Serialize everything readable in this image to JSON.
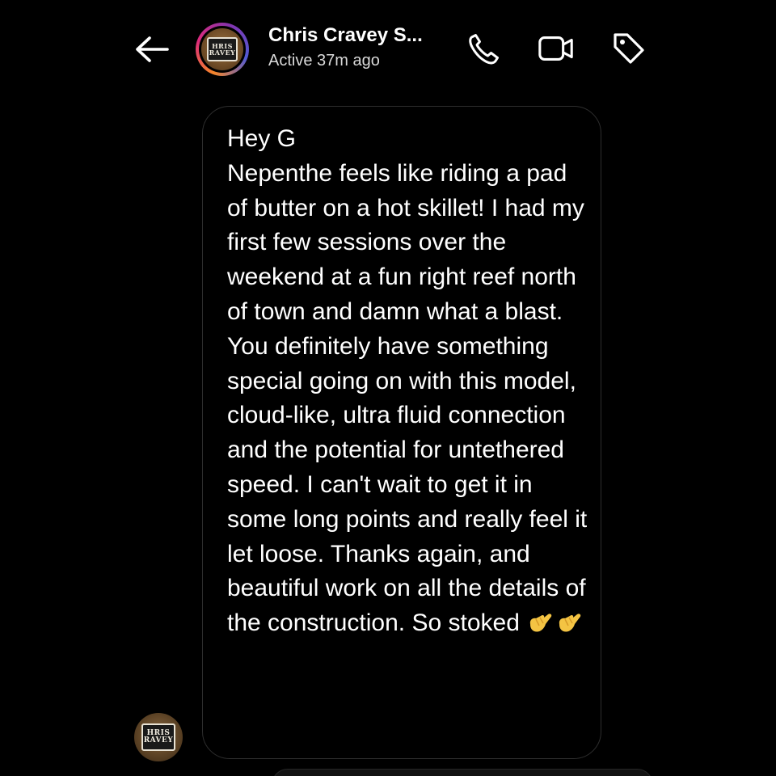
{
  "header": {
    "back_icon": "arrow-left-icon",
    "contact_name": "Chris Cravey S...",
    "status": "Active 37m ago",
    "avatar_logo_lines": [
      "HRIS",
      "RAVEY"
    ],
    "actions": [
      {
        "name": "voice-call",
        "icon": "phone-icon"
      },
      {
        "name": "video-call",
        "icon": "video-camera-icon"
      },
      {
        "name": "tag",
        "icon": "tag-icon"
      }
    ]
  },
  "message": {
    "text": "Hey G\nNepenthe feels like riding a pad of butter on a hot skillet! I had my first few sessions over the weekend at a fun right reef north of town and damn what a blast. You definitely have something special going on with this model, cloud-like, ultra fluid connection and the potential for untethered speed. I can't wait to get it in some long points and really feel it let loose. Thanks again, and beautiful work on all the details of the construction. So stoked",
    "emoji": [
      "call-me-hand-emoji",
      "call-me-hand-emoji"
    ]
  },
  "sender_avatar": {
    "logo_lines": [
      "HRIS",
      "RAVEY"
    ]
  },
  "colors": {
    "background": "#000000",
    "text_primary": "#ffffff",
    "text_secondary": "#d9d9d9",
    "bubble_border": "#2e2e2e",
    "emoji_skin": "#f4c443"
  }
}
